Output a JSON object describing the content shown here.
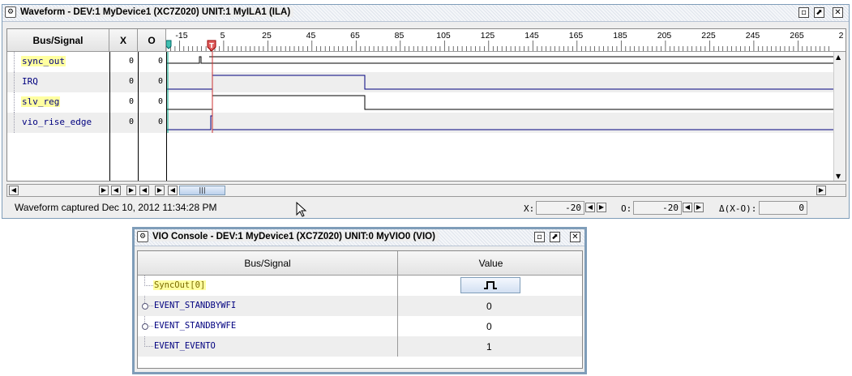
{
  "waveform": {
    "title": "Waveform - DEV:1 MyDevice1 (XC7Z020) UNIT:1 MyILA1 (ILA)",
    "columns": {
      "signal": "Bus/Signal",
      "x": "X",
      "o": "O"
    },
    "signals": [
      {
        "name": "sync_out",
        "x": "0",
        "o": "0",
        "highlight": true,
        "expandable": false
      },
      {
        "name": "IRQ",
        "x": "0",
        "o": "0",
        "highlight": false,
        "expandable": false
      },
      {
        "name": "slv_reg",
        "x": "0",
        "o": "0",
        "highlight": true,
        "expandable": false
      },
      {
        "name": "vio_rise_edge",
        "x": "0",
        "o": "0",
        "highlight": false,
        "expandable": false
      }
    ],
    "time_ruler": [
      "-15",
      "5",
      "25",
      "45",
      "65",
      "85",
      "105",
      "125",
      "145",
      "165",
      "185",
      "205",
      "225",
      "245",
      "265",
      "2"
    ],
    "trigger_marker": "T",
    "status": "Waveform captured Dec 10, 2012 11:34:28 PM",
    "x_label": "X:",
    "x_value": "-20",
    "o_label": "O:",
    "o_value": "-20",
    "delta_label": "Δ(X-O):",
    "delta_value": "0"
  },
  "vio": {
    "title": "VIO Console - DEV:1 MyDevice1 (XC7Z020) UNIT:0 MyVIO0 (VIO)",
    "columns": {
      "signal": "Bus/Signal",
      "value": "Value"
    },
    "rows": [
      {
        "name": "SyncOut[0]",
        "value": "",
        "kind": "pulse-button",
        "highlight": true
      },
      {
        "name": "EVENT_STANDBYWFI",
        "value": "0",
        "kind": "value",
        "highlight": false
      },
      {
        "name": "EVENT_STANDBYWFE",
        "value": "0",
        "kind": "value",
        "highlight": false
      },
      {
        "name": "EVENT_EVENTO",
        "value": "1",
        "kind": "value",
        "highlight": false
      }
    ]
  },
  "colors": {
    "trace_black": "#000000",
    "trace_blue": "#00007f",
    "cursor": "#cc3333",
    "highlight": "#ffffa0",
    "border": "#7f9db9"
  }
}
